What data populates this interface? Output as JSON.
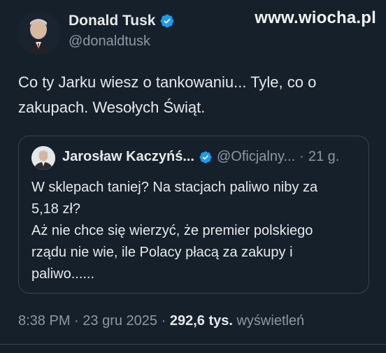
{
  "watermark": "www.wiocha.pl",
  "tweet": {
    "author_name": "Donald Tusk",
    "handle": "@donaldtusk",
    "verified": true,
    "text": "Co ty Jarku wiesz o tankowaniu... Tyle, co o zakupach. Wesołych Świąt."
  },
  "quoted_tweet": {
    "author_name": "Jarosław Kaczyńś...",
    "handle": "@Oficjalny...",
    "separator": "·",
    "time": "21 g.",
    "verified": true,
    "text_lines": [
      "W sklepach taniej? Na stacjach paliwo niby za",
      "5,18 zł?",
      "Aż nie chce się wierzyć, że premier polskiego",
      "rządu nie wie, ile Polacy płacą za zakupy i",
      "paliwo......"
    ]
  },
  "meta": {
    "time": "8:38 PM",
    "sep1": "·",
    "date": "23 gru 2025",
    "sep2": "·",
    "views_count": "292,6 tys.",
    "views_label": "wyświetleń"
  },
  "colors": {
    "background": "#15202b",
    "verified_badge": "#1d9bf0",
    "secondary_text": "#8b98a5",
    "primary_text": "#e7e9ea",
    "border": "#38444d"
  },
  "icons": {
    "verified": "verified-badge-icon",
    "avatar": "avatar-photo",
    "quoted_avatar": "avatar-photo"
  }
}
